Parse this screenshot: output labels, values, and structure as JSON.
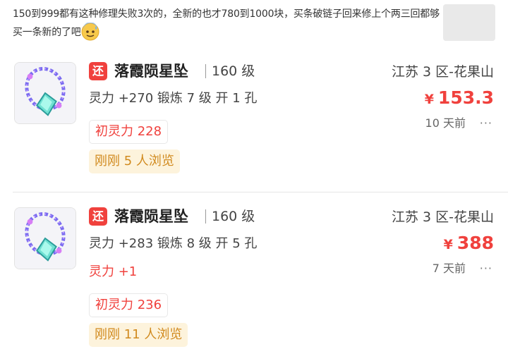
{
  "comment": {
    "text": "150到999都有这种修理失败3次的，全新的也才780到1000块，买条破链子回来修上个两三回都够买一条新的了吧",
    "emoji_icon": "sweat-smile-emoji-icon"
  },
  "listings": [
    {
      "tag": "还",
      "name": "落霞陨星坠",
      "level": "160 级",
      "server": "江苏 3 区-花果山",
      "attrs": "灵力 +270 锻炼 7 级 开 1 孔",
      "currency": "¥",
      "price": "153.3",
      "time": "10 天前",
      "more": "···",
      "extra": "",
      "base_spirit": "初灵力 228",
      "views": "刚刚 5 人浏览"
    },
    {
      "tag": "还",
      "name": "落霞陨星坠",
      "level": "160 级",
      "server": "江苏 3 区-花果山",
      "attrs": "灵力 +283 锻炼 8 级 开 5 孔",
      "currency": "¥",
      "price": "388",
      "time": "7 天前",
      "more": "···",
      "extra": "灵力 +1",
      "base_spirit": "初灵力 236",
      "views": "刚刚 11 人浏览"
    }
  ],
  "colors": {
    "accent_red": "#f0413d",
    "chip_yellow_bg": "#fdf3dc",
    "chip_yellow_text": "#d18a1e"
  }
}
